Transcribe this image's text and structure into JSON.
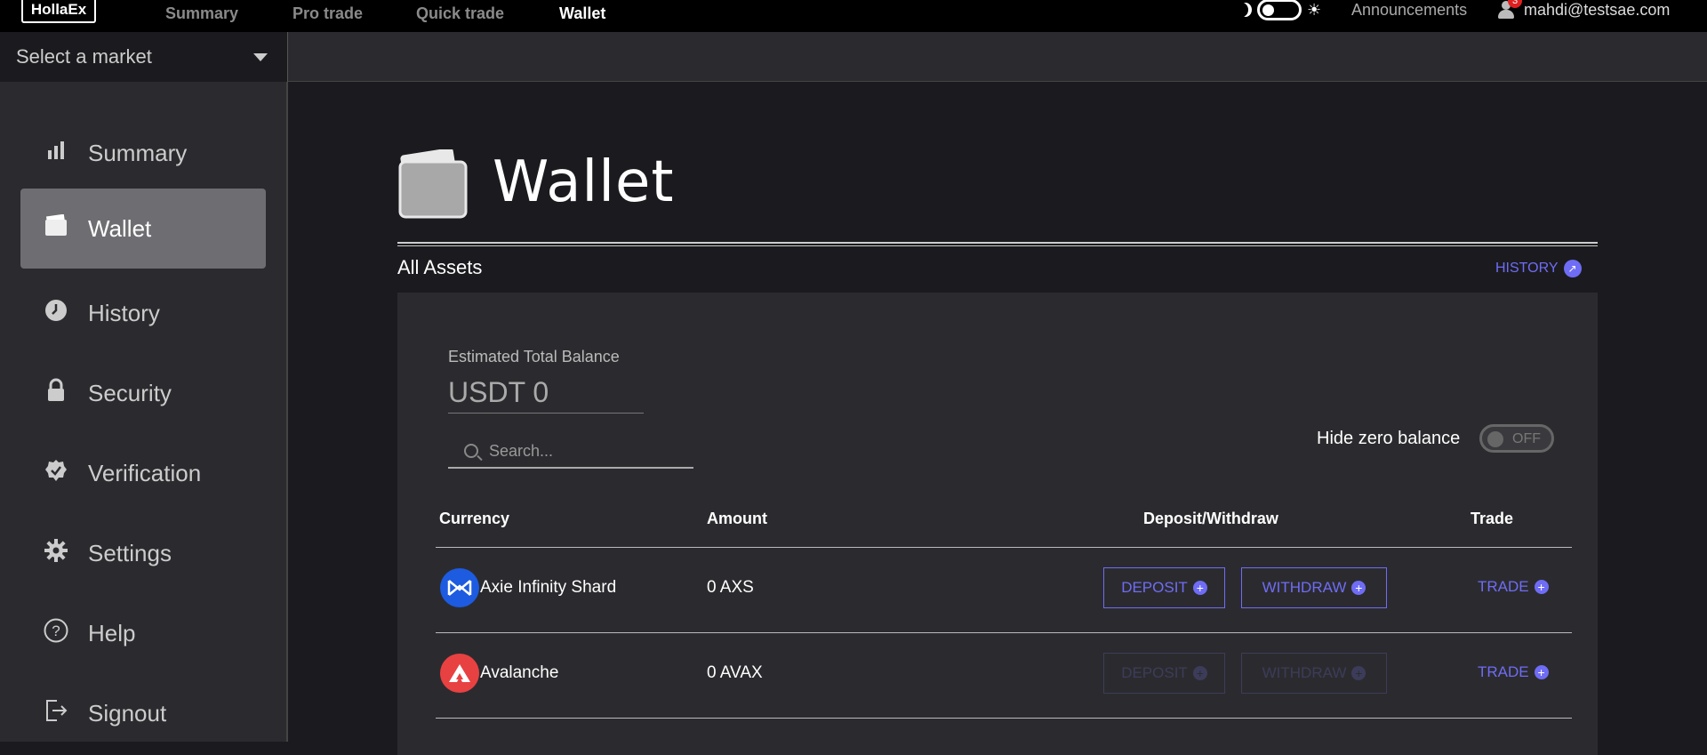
{
  "topbar": {
    "logo": "HollaEx",
    "nav": [
      "Summary",
      "Pro trade",
      "Quick trade",
      "Wallet"
    ],
    "announcements": "Announcements",
    "user_email": "mahdi@testsae.com",
    "notification_count": "3"
  },
  "market": {
    "placeholder": "Select a market"
  },
  "sidebar": {
    "items": [
      {
        "label": "Summary",
        "icon": "bar-chart-icon"
      },
      {
        "label": "Wallet",
        "icon": "wallet-icon"
      },
      {
        "label": "History",
        "icon": "clock-icon"
      },
      {
        "label": "Security",
        "icon": "lock-icon"
      },
      {
        "label": "Verification",
        "icon": "check-badge-icon"
      },
      {
        "label": "Settings",
        "icon": "gear-icon"
      },
      {
        "label": "Help",
        "icon": "help-icon"
      },
      {
        "label": "Signout",
        "icon": "signout-icon"
      }
    ]
  },
  "wallet": {
    "title": "Wallet",
    "all_assets": "All Assets",
    "history_link": "HISTORY",
    "est_label": "Estimated Total Balance",
    "est_value": "USDT 0",
    "search_placeholder": "Search...",
    "hide_zero": "Hide zero balance",
    "toggle": "OFF",
    "columns": [
      "Currency",
      "Amount",
      "Deposit/Withdraw",
      "Trade"
    ],
    "rows": [
      {
        "name": "Axie Infinity Shard",
        "amount": "0 AXS",
        "deposit": "DEPOSIT",
        "withdraw": "WITHDRAW",
        "trade": "TRADE",
        "enabled": true,
        "color": "#1d5be0"
      },
      {
        "name": "Avalanche",
        "amount": "0 AVAX",
        "deposit": "DEPOSIT",
        "withdraw": "WITHDRAW",
        "trade": "TRADE",
        "enabled": false,
        "color": "#e84142"
      }
    ]
  },
  "colors": {
    "accent": "#6f6cf5",
    "background": "#1b1b1f",
    "panel": "#2b2b2f"
  }
}
